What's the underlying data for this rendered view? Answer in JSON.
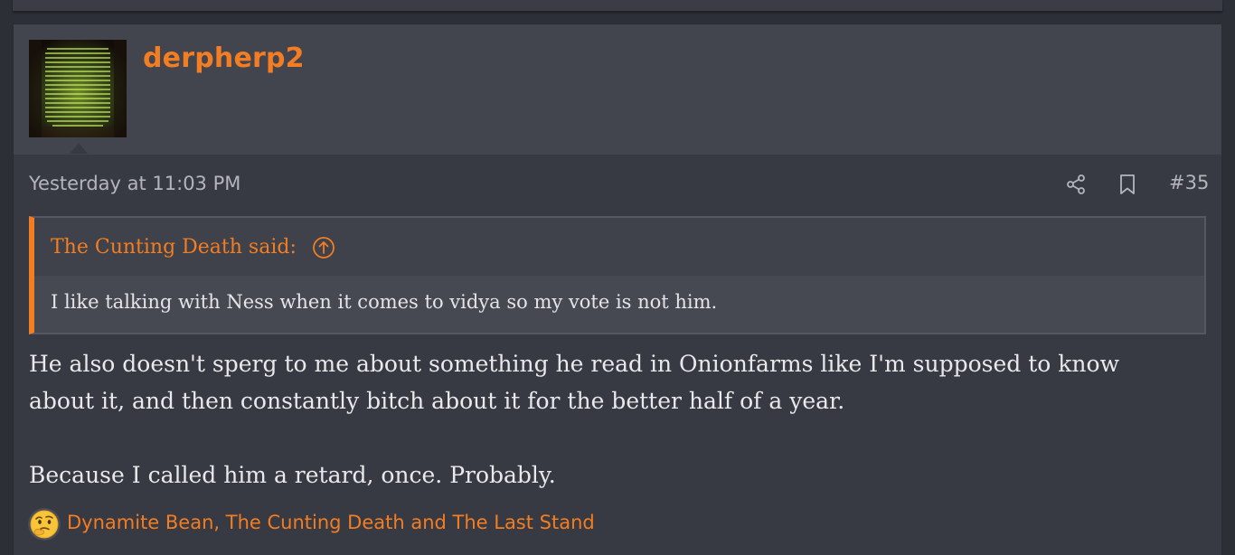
{
  "post": {
    "username": "derpherp2",
    "date": "Yesterday at 11:03 PM",
    "post_number": "#35",
    "icons": {
      "share": "share-icon",
      "bookmark": "bookmark-icon",
      "quote_jump": "arrow-up-circle-icon",
      "reaction": "thinking-face-icon"
    },
    "quote": {
      "author": "The Cunting Death said:",
      "text": "I like talking with Ness when it comes to vidya so my vote is not him."
    },
    "message": {
      "line1": "He also doesn't sperg to me about something he read in Onionfarms like I'm supposed to know",
      "line2": "about it, and then constantly bitch about it for the better half of a year.",
      "line3": "Because I called him a retard, once. Probably."
    },
    "reactions": {
      "users": "Dynamite Bean, The Cunting Death and The Last Stand"
    }
  },
  "colors": {
    "accent": "#f37d22",
    "background": "#2c2f36",
    "post_background": "#373a42",
    "header_background": "#42454e",
    "text": "#e8e9eb",
    "muted_text": "#b3b5ba"
  }
}
